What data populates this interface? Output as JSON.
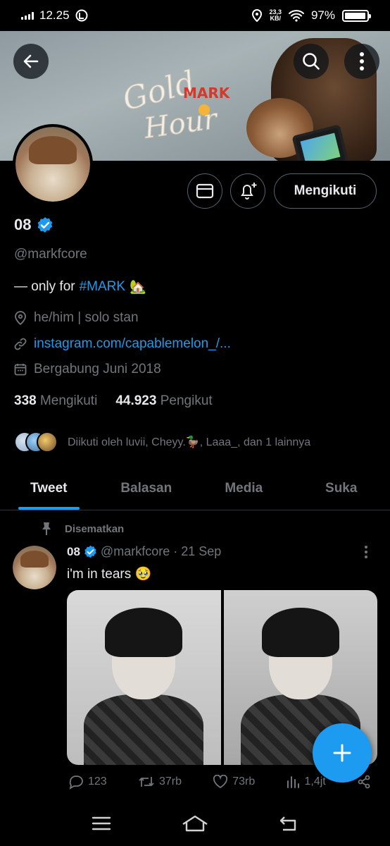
{
  "status_bar": {
    "time": "12.25",
    "net_speed_value": "23,3",
    "net_speed_unit": "KB/",
    "battery": "97%",
    "battery_level": 0.97
  },
  "header": {
    "banner_text": "MARK",
    "banner_title": "Golden Hour"
  },
  "profile": {
    "follow_label": "Mengikuti",
    "display_name": "08",
    "handle": "@markfcore",
    "bio_prefix": "— only for",
    "bio_hashtag": "#MARK",
    "bio_emoji": "🏡",
    "pronouns": "he/him | solo stan",
    "website": "instagram.com/capablemelon_/...",
    "joined": "Bergabung Juni 2018",
    "following_count": "338",
    "following_label": "Mengikuti",
    "followers_count": "44.923",
    "followers_label": "Pengikut",
    "followed_by": "Diikuti oleh luvii, Cheyy.🦆, Laaa_, dan 1 lainnya"
  },
  "tabs": [
    {
      "label": "Tweet",
      "active": true
    },
    {
      "label": "Balasan",
      "active": false
    },
    {
      "label": "Media",
      "active": false
    },
    {
      "label": "Suka",
      "active": false
    }
  ],
  "tweet": {
    "pinned_label": "Disematkan",
    "author_name": "08",
    "author_handle": "@markfcore",
    "separator": "·",
    "date": "21 Sep",
    "text": "i'm in tears 🥹",
    "replies": "123",
    "retweets": "37rb",
    "likes": "73rb",
    "views": "1,4jt"
  },
  "colors": {
    "accent": "#1d9bf0",
    "background": "#000000",
    "muted_text": "#71767b"
  }
}
